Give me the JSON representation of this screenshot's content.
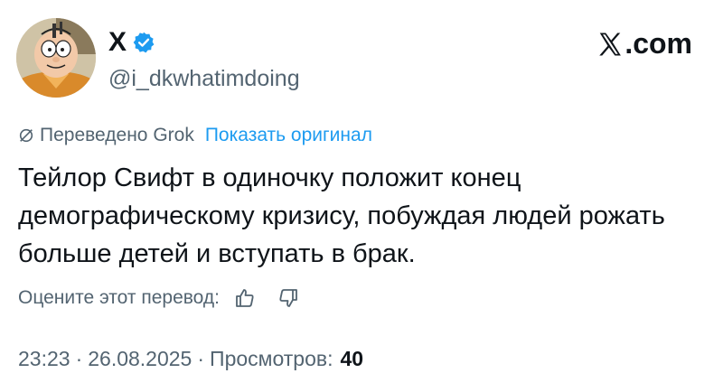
{
  "author": {
    "name": "X",
    "handle": "@i_dkwhatimdoing",
    "verified": true,
    "avatar_icon": "cartoon-character-avatar"
  },
  "brand": {
    "label": ".com",
    "logo_icon": "x-logo-icon"
  },
  "translation": {
    "label": "Переведено Grok",
    "show_original": "Показать оригинал"
  },
  "tweet": {
    "text": "Тейлор Свифт в одиночку положит конец демографическому кризису, побуждая людей рожать больше детей и вступать в брак."
  },
  "rating": {
    "label": "Оцените этот перевод:",
    "like_icon": "thumbs-up-icon",
    "dislike_icon": "thumbs-down-icon"
  },
  "meta": {
    "time": "23:23",
    "date": "26.08.2025",
    "views_label": "Просмотров:",
    "views_count": "40"
  },
  "colors": {
    "text": "#0f1419",
    "secondary": "#536471",
    "link": "#1d9bf0",
    "verified": "#1d9bf0"
  }
}
